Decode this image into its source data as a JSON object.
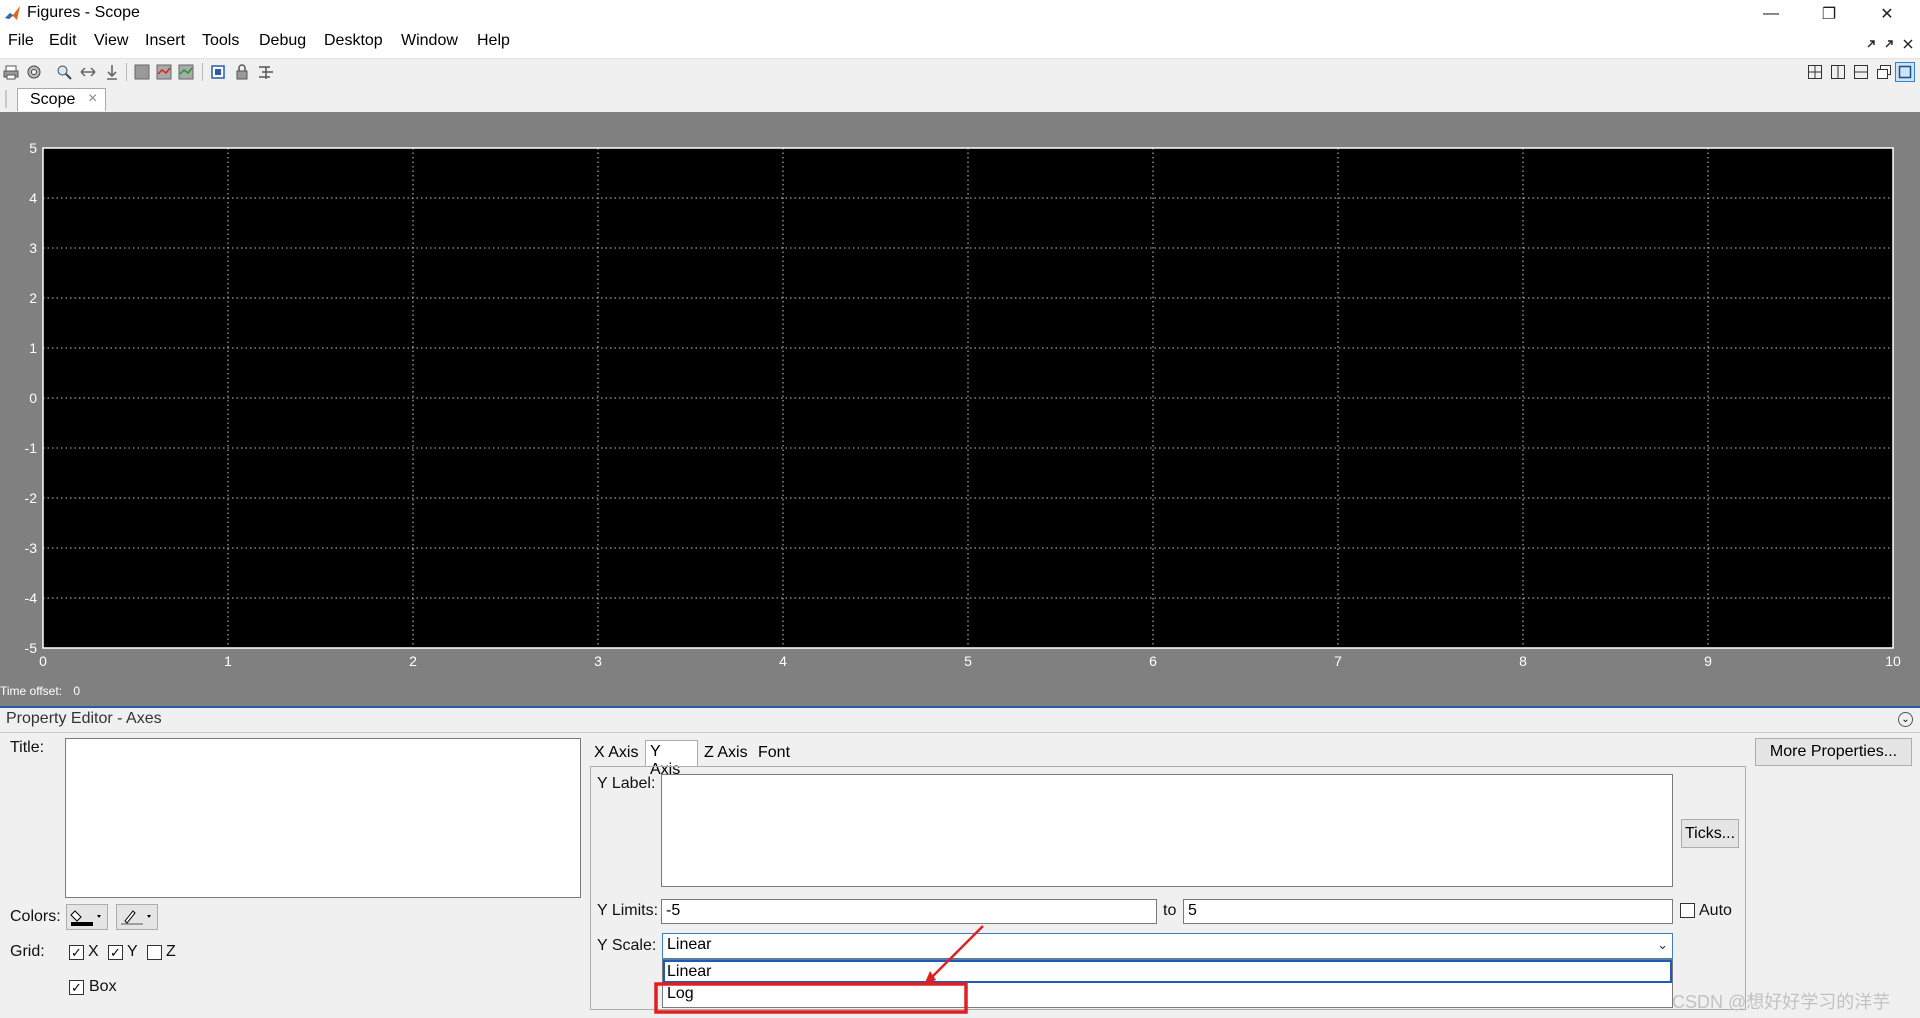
{
  "window": {
    "title": "Figures - Scope",
    "controls": {
      "minimize": "—",
      "restore": "❐",
      "close": "✕"
    }
  },
  "menu": [
    "File",
    "Edit",
    "View",
    "Insert",
    "Tools",
    "Debug",
    "Desktop",
    "Window",
    "Help"
  ],
  "tabs": [
    {
      "label": "Scope",
      "close": "×"
    }
  ],
  "chart_data": {
    "type": "line",
    "x_ticks": [
      "0",
      "1",
      "2",
      "3",
      "4",
      "5",
      "6",
      "7",
      "8",
      "9",
      "10"
    ],
    "y_ticks": [
      "5",
      "4",
      "3",
      "2",
      "1",
      "0",
      "-1",
      "-2",
      "-3",
      "-4",
      "-5"
    ],
    "xlim": [
      0,
      10
    ],
    "ylim": [
      -5,
      5
    ],
    "grid": true,
    "background": "#000000",
    "grid_color": "#ffffff",
    "series": []
  },
  "time_offset": {
    "label": "Time offset:",
    "value": "0"
  },
  "property_editor": {
    "header": "Property Editor - Axes",
    "title_label": "Title:",
    "title_value": "",
    "colors_label": "Colors:",
    "grid_label": "Grid:",
    "grid_x": "X",
    "grid_y": "Y",
    "grid_z": "Z",
    "box_label": "Box",
    "tabs": [
      "X Axis",
      "Y Axis",
      "Z Axis",
      "Font"
    ],
    "active_tab": "Y Axis",
    "ylabel_label": "Y Label:",
    "ylabel_value": "",
    "ylimits_label": "Y Limits:",
    "ylimits_min": "-5",
    "ylimits_to": "to",
    "ylimits_max": "5",
    "auto_label": "Auto",
    "yscale_label": "Y Scale:",
    "yscale_value": "Linear",
    "yscale_options": [
      "Linear",
      "Log"
    ],
    "ticks_button": "Ticks...",
    "more_properties_button": "More Properties..."
  },
  "watermark": "CSDN @想好好学习的洋芋",
  "annotation_color": "#e02020"
}
